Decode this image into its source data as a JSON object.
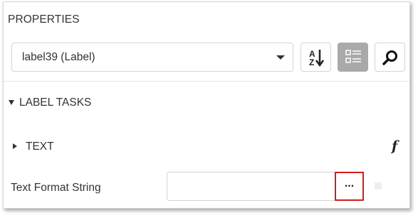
{
  "panel": {
    "title": "PROPERTIES"
  },
  "object_selector": {
    "value": "label39 (Label)",
    "icon": "chevron-down-icon"
  },
  "toolbar": {
    "sort_icon": "sort-alphabetical-icon",
    "categorized_icon": "categorized-view-icon",
    "categorized_active": true,
    "search_icon": "search-icon",
    "active_bg": "#a9a9a9"
  },
  "tasks_section": {
    "title": "LABEL TASKS",
    "expanded": true
  },
  "text_section": {
    "title": "TEXT",
    "expanded": false,
    "expression_icon": "function-icon",
    "expression_glyph": "f"
  },
  "property": {
    "label": "Text Format String",
    "value": "",
    "ellipsis_label": "...",
    "highlight_color": "#d11d1d"
  }
}
